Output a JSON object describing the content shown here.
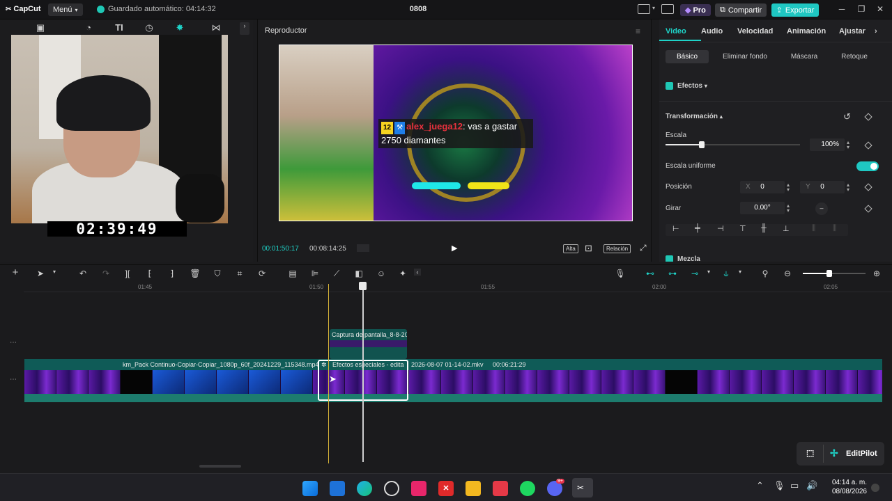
{
  "app": {
    "logo": "CapCut",
    "menu_label": "Menú",
    "autosave": "Guardado automático: 04:14:32",
    "project_name": "0808",
    "pro_label": "Pro",
    "share_label": "Compartir",
    "export_label": "Exportar"
  },
  "left_panel": {
    "tabs": [
      "media-icon",
      "audio-icon",
      "text-icon",
      "sticker-icon",
      "effects-icon",
      "transition-icon"
    ],
    "webcam_clock": "02:39:49"
  },
  "player": {
    "title": "Reproductor",
    "chat": {
      "badge": "12",
      "user": "alex_juega12",
      "message_a": ": vas a gastar",
      "message_b": "2750 diamantes"
    },
    "current_time": "00:01:50:17",
    "total_time": "00:08:14:25",
    "btn_alta": "Alta",
    "btn_relacion": "Relación"
  },
  "inspector": {
    "tabs": [
      "Video",
      "Audio",
      "Velocidad",
      "Animación",
      "Ajustar"
    ],
    "subtabs": [
      "Básico",
      "Eliminar fondo",
      "Máscara",
      "Retoque"
    ],
    "efectos_label": "Efectos",
    "transformacion_label": "Transformación",
    "escala_label": "Escala",
    "escala_value": "100%",
    "escala_level": 0.27,
    "escala_uniforme_label": "Escala uniforme",
    "posicion_label": "Posición",
    "pos_x_label": "X",
    "pos_x": "0",
    "pos_y_label": "Y",
    "pos_y": "0",
    "girar_label": "Girar",
    "girar_value": "0.00°",
    "mezcla_label": "Mezcla"
  },
  "timeline": {
    "ruler": [
      "01:45",
      "01:50",
      "01:55",
      "02:00",
      "02:05"
    ],
    "top_clip": "Captura de pantalla_8-8-20",
    "main_clip_a": "km_Pack Continuo-Copiar-Copiar_1080p_60f_20241229_115348.mp4",
    "main_clip_b": "Efectos especiales - edita",
    "main_clip_c": "2026-08-07 01-14-02.mkv",
    "main_clip_d": "00:06:21:29",
    "editpilot": "EditPilot"
  },
  "taskbar": {
    "time": "04:14 a. m.",
    "date": "08/08/2026",
    "discord_badge": "9+"
  },
  "colors": {
    "accent": "#1fd3c8",
    "background": "#1b1b1d",
    "clip": "#0f5b57"
  }
}
